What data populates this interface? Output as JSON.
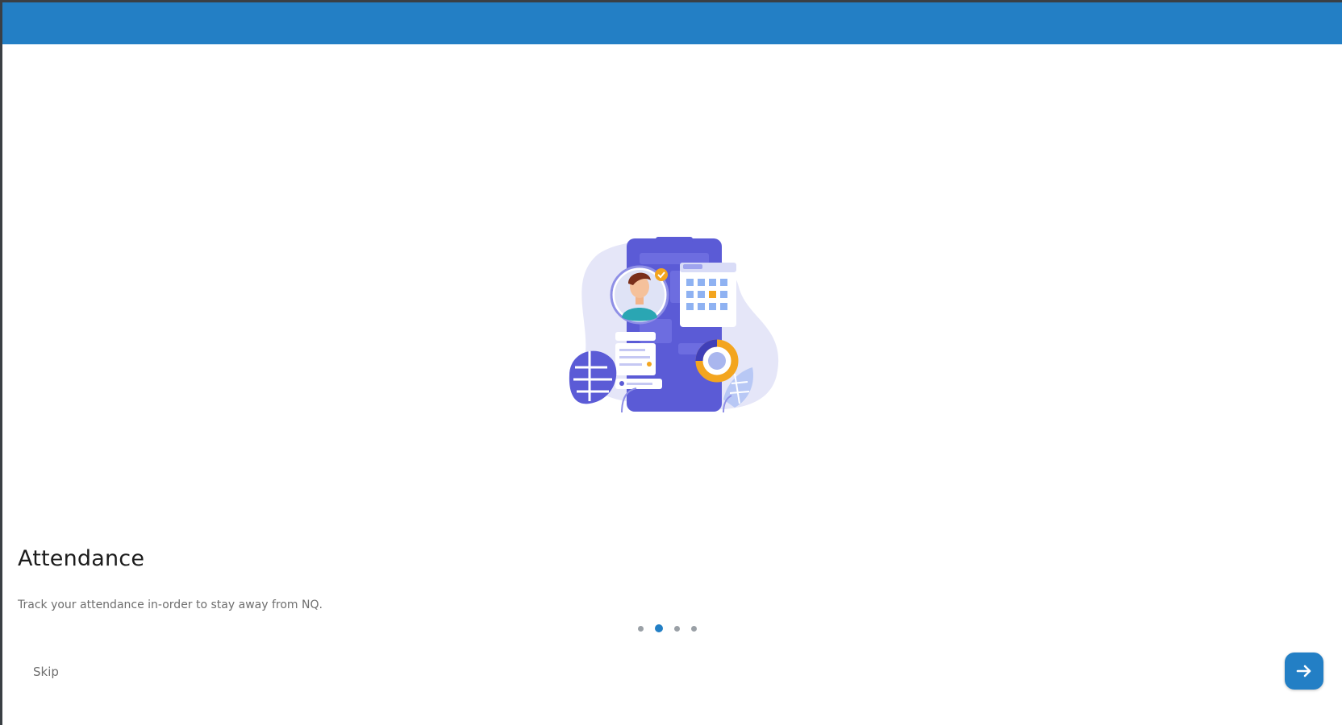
{
  "colors": {
    "app_bar": "#237fc5",
    "accent": "#237fc5",
    "illustration_primary": "#5b5bd6",
    "illustration_light": "#e5e6f8",
    "illustration_orange": "#f3a51f"
  },
  "onboarding": {
    "title": "Attendance",
    "description": "Track your attendance in-order to stay away from NQ.",
    "pages_total": 4,
    "current_page": 2,
    "illustration_icon": "attendance-phone-illustration"
  },
  "footer": {
    "skip_label": "Skip",
    "next_icon": "arrow-right-icon"
  }
}
